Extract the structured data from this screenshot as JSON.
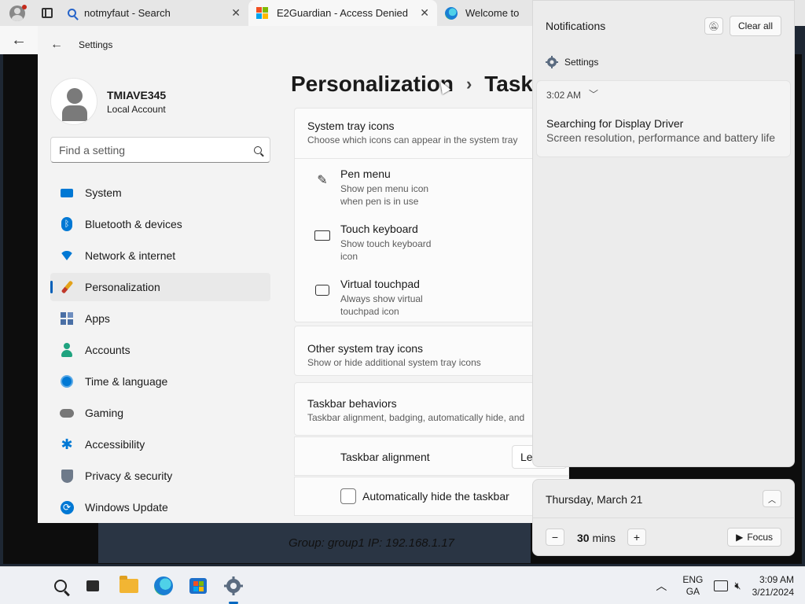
{
  "browser": {
    "tabs": [
      {
        "label": "notmyfaut - Search",
        "icon": "search-icon"
      },
      {
        "label": "E2Guardian - Access Denied",
        "icon": "microsoft-icon"
      },
      {
        "label": "Welcome to Mi",
        "icon": "edge-icon"
      }
    ],
    "close_glyph": "✕",
    "back_glyph": "←"
  },
  "settings": {
    "title": "Settings",
    "user": {
      "name": "TMIAVE345",
      "account_type": "Local Account"
    },
    "search_placeholder": "Find a setting",
    "nav": [
      {
        "label": "System",
        "icon": "system-icon",
        "color": "#0078d4"
      },
      {
        "label": "Bluetooth & devices",
        "icon": "bluetooth-icon",
        "color": "#0078d4"
      },
      {
        "label": "Network & internet",
        "icon": "wifi-icon",
        "color": "#0078d4"
      },
      {
        "label": "Personalization",
        "icon": "brush-icon",
        "color": "#e3a21a",
        "selected": true
      },
      {
        "label": "Apps",
        "icon": "apps-icon",
        "color": "#4a6fa5"
      },
      {
        "label": "Accounts",
        "icon": "person-icon",
        "color": "#1fa37f"
      },
      {
        "label": "Time & language",
        "icon": "globe-clock-icon",
        "color": "#0078d4"
      },
      {
        "label": "Gaming",
        "icon": "gamepad-icon",
        "color": "#666666"
      },
      {
        "label": "Accessibility",
        "icon": "accessibility-icon",
        "color": "#0078d4"
      },
      {
        "label": "Privacy & security",
        "icon": "shield-icon",
        "color": "#6e7a8a"
      },
      {
        "label": "Windows Update",
        "icon": "update-icon",
        "color": "#0078d4"
      }
    ],
    "breadcrumb": {
      "parent": "Personalization",
      "separator": "›",
      "current": "Taskb"
    },
    "system_tray": {
      "title": "System tray icons",
      "subtitle": "Choose which icons can appear in the system tray",
      "items": [
        {
          "title": "Pen menu",
          "subtitle": "Show pen menu icon when pen is in use",
          "icon": "pen-icon"
        },
        {
          "title": "Touch keyboard",
          "subtitle": "Show touch keyboard icon",
          "icon": "keyboard-icon"
        },
        {
          "title": "Virtual touchpad",
          "subtitle": "Always show virtual touchpad icon",
          "icon": "touchpad-icon"
        }
      ]
    },
    "other_tray": {
      "title": "Other system tray icons",
      "subtitle": "Show or hide additional system tray icons"
    },
    "behaviors": {
      "title": "Taskbar behaviors",
      "subtitle": "Taskbar alignment, badging, automatically hide, and",
      "alignment_label": "Taskbar alignment",
      "alignment_value": "Le",
      "autohide_label": "Automatically hide the taskbar"
    }
  },
  "background": {
    "status": "Group: group1   IP: 192.168.1.17"
  },
  "notifications": {
    "title": "Notifications",
    "clear_all": "Clear all",
    "app": "Settings",
    "time": "3:02 AM",
    "item_title": "Searching for Display Driver",
    "item_body": "Screen resolution, performance and battery life"
  },
  "calendar": {
    "date": "Thursday, March 21",
    "minutes": "30",
    "minutes_unit": "mins",
    "focus_label": "Focus"
  },
  "taskbar": {
    "lang_top": "ENG",
    "lang_bottom": "GA",
    "time": "3:09 AM",
    "date": "3/21/2024"
  }
}
